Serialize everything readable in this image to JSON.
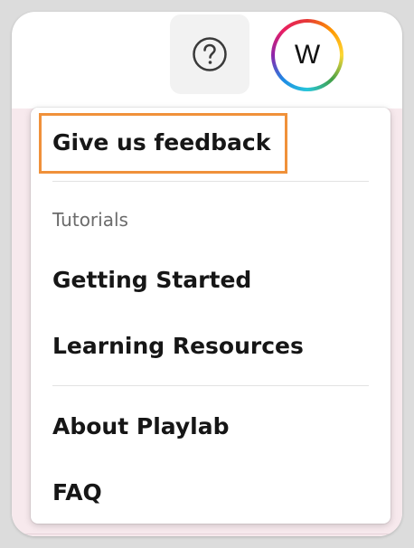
{
  "header": {
    "help_icon": "question-circle-icon",
    "avatar_initial": "W"
  },
  "menu": {
    "feedback_label": "Give us feedback",
    "section_label": "Tutorials",
    "items": [
      {
        "label": "Getting Started"
      },
      {
        "label": "Learning Resources"
      },
      {
        "label": "About Playlab"
      },
      {
        "label": "FAQ"
      }
    ]
  },
  "colors": {
    "highlight": "#f0913a",
    "background_panel": "#f7e9ed"
  }
}
